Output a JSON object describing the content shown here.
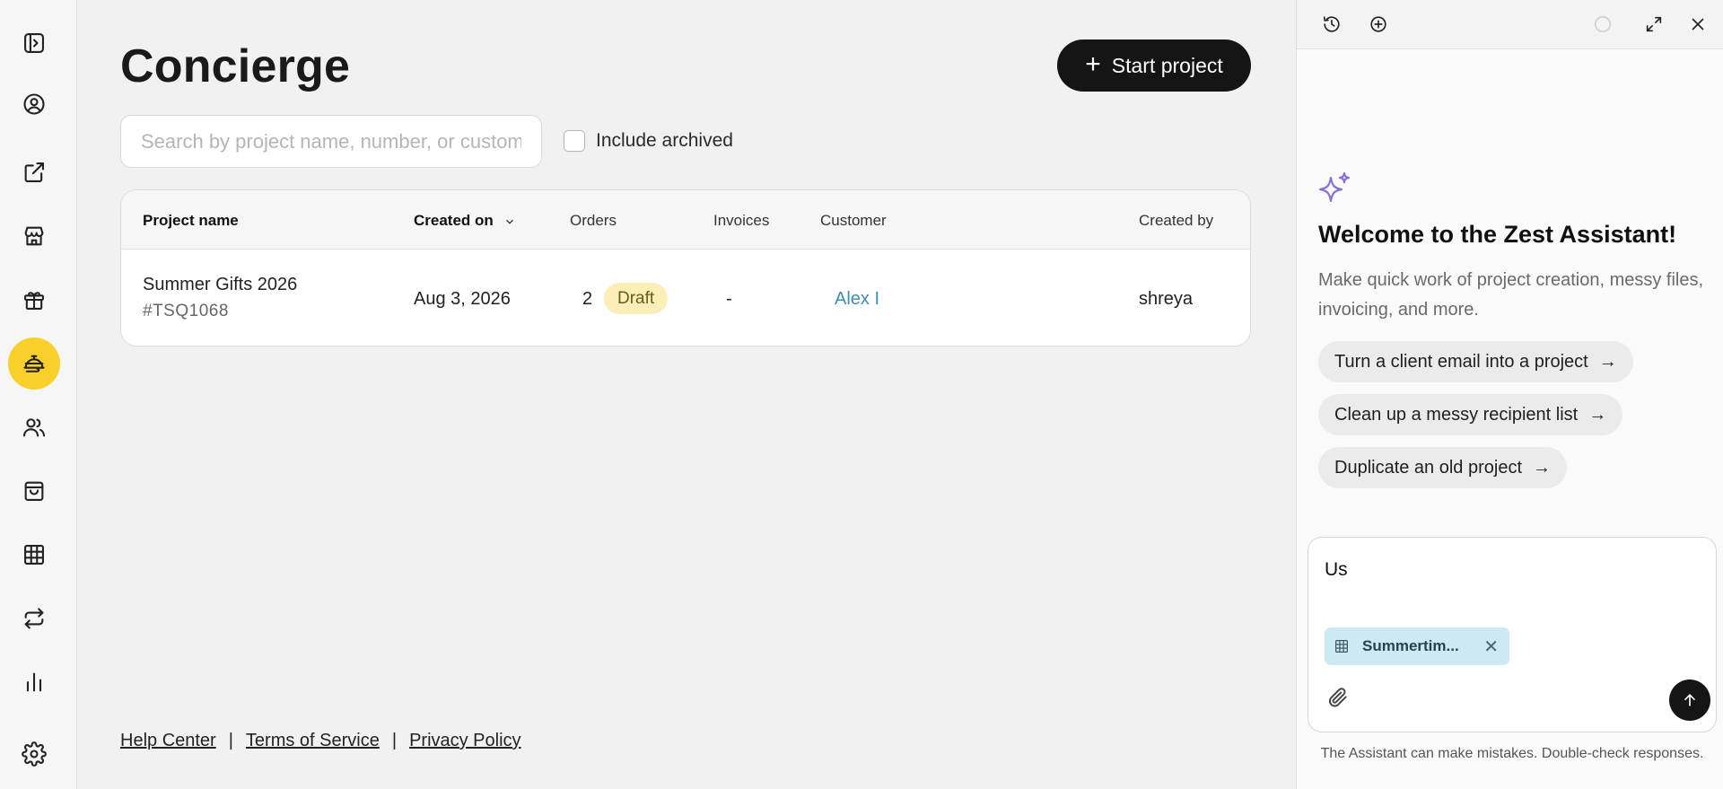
{
  "page": {
    "title": "Concierge",
    "start_project_label": "Start project"
  },
  "search": {
    "placeholder": "Search by project name, number, or customer",
    "value": ""
  },
  "filters": {
    "include_archived_label": "Include archived",
    "include_archived_checked": false
  },
  "table": {
    "columns": [
      "Project name",
      "Created on",
      "Orders",
      "Invoices",
      "Customer",
      "Created by"
    ],
    "rows": [
      {
        "project_name": "Summer Gifts 2026",
        "project_number": "#TSQ1068",
        "created_on": "Aug 3, 2026",
        "orders": "2",
        "status": "Draft",
        "invoices": "-",
        "customer": "Alex I",
        "created_by": "shreya"
      }
    ]
  },
  "footer": {
    "help": "Help Center",
    "terms": "Terms of Service",
    "privacy": "Privacy Policy",
    "sep": "|"
  },
  "sidebar": {
    "items": [
      {
        "icon": "sidebar-toggle-icon"
      },
      {
        "icon": "user-circle-icon"
      },
      {
        "icon": "external-link-icon"
      },
      {
        "icon": "storefront-icon"
      },
      {
        "icon": "gift-icon"
      },
      {
        "icon": "concierge-bell-icon",
        "active": true
      },
      {
        "icon": "users-icon"
      },
      {
        "icon": "shopping-bag-icon"
      },
      {
        "icon": "grid-table-icon"
      },
      {
        "icon": "swap-arrows-icon"
      },
      {
        "icon": "bar-chart-icon"
      },
      {
        "icon": "gear-icon"
      }
    ]
  },
  "assistant": {
    "welcome": "Welcome to the Zest Assistant!",
    "description": "Make quick work of project creation, messy files, invoicing, and more.",
    "suggestions": [
      "Turn a client email into a project",
      "Clean up a messy recipient list",
      "Duplicate an old project"
    ],
    "input_value": "Us",
    "attachment_name": "Summertim...",
    "disclaimer": "The Assistant can make mistakes. Double-check responses."
  },
  "colors": {
    "accent": "#f9cf2a",
    "link": "#3f8fac",
    "draft_badge": "#fbeeb6",
    "attachment": "#cdeaf3",
    "sparkle": "#8b6fd8"
  }
}
